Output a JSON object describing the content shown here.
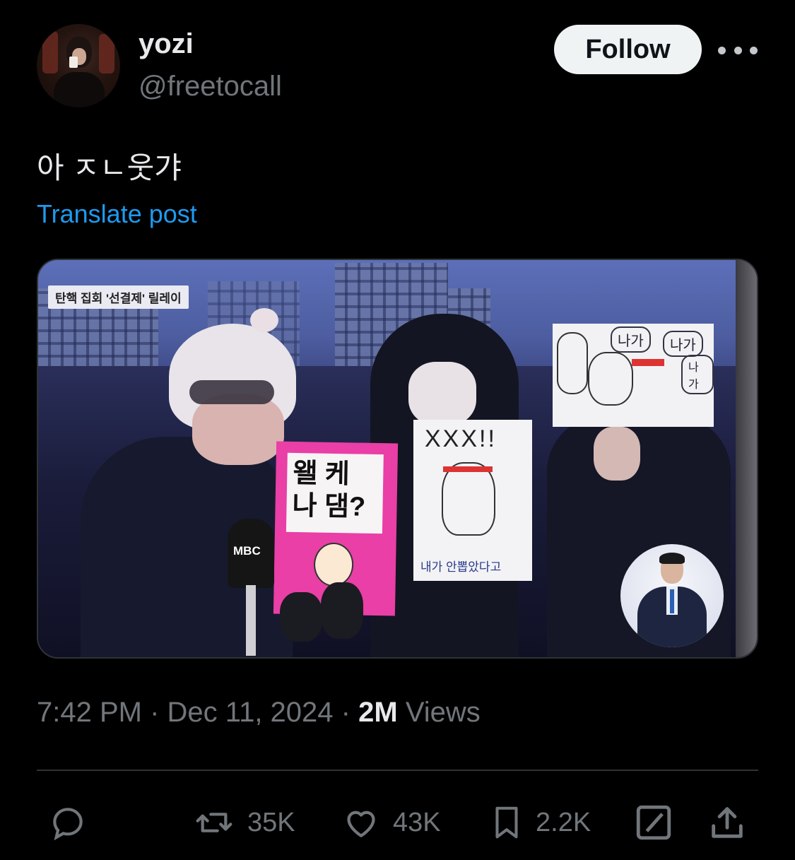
{
  "author": {
    "display_name": "yozi",
    "handle": "@freetocall",
    "follow_label": "Follow",
    "avatar_icon": "user-avatar"
  },
  "post": {
    "text": "아 ㅈㄴ웃갸",
    "translate_label": "Translate post"
  },
  "media": {
    "news_caption": "탄핵 집회 '선결제' 릴레이",
    "broadcaster": "MBC",
    "signs": {
      "pink": "왤 케\n나 댐?",
      "cartoon_top": "XXX!!",
      "cartoon_bottom": "내가 안뽑았다고",
      "speech_1": "나가",
      "speech_2": "나가",
      "speech_3": "나가"
    }
  },
  "meta": {
    "time": "7:42 PM",
    "date": "Dec 11, 2024",
    "views_count": "2M",
    "views_label": "Views",
    "separator": "·"
  },
  "actions": {
    "reply_icon": "reply-icon",
    "retweet_count": "35K",
    "like_count": "43K",
    "bookmark_count": "2.2K",
    "edit_icon": "grok-icon",
    "share_icon": "share-icon"
  }
}
